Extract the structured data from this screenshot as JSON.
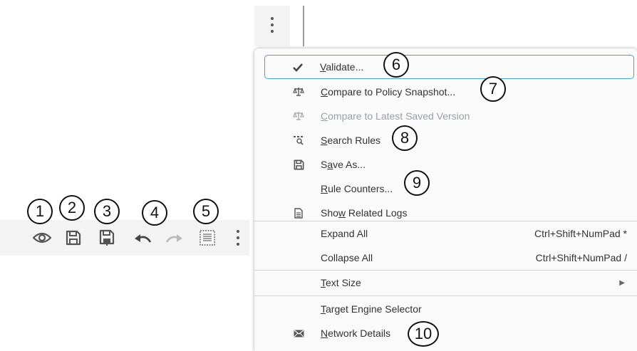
{
  "callouts": [
    "1",
    "2",
    "3",
    "4",
    "5",
    "6",
    "7",
    "8",
    "9",
    "10"
  ],
  "menu": {
    "items": [
      {
        "key": "validate",
        "underline": "V",
        "rest": "alidate...",
        "icon": "checkmark-icon"
      },
      {
        "key": "compare-snapshot",
        "underline": "C",
        "rest": "ompare to Policy Snapshot...",
        "icon": "balance-scale-icon"
      },
      {
        "key": "compare-latest",
        "underline": "C",
        "rest": "ompare to Latest Saved Version",
        "icon": "balance-scale-icon",
        "disabled": true
      },
      {
        "key": "search-rules",
        "underline": "S",
        "rest": "earch Rules",
        "icon": "search-rules-icon"
      },
      {
        "key": "save-as",
        "pre": "S",
        "underline": "a",
        "rest": "ve As...",
        "icon": "save-icon"
      },
      {
        "key": "rule-counters",
        "underline": "R",
        "rest": "ule Counters...",
        "icon": ""
      },
      {
        "key": "show-related-logs",
        "pre": "Sho",
        "underline": "w",
        "rest": " Related Logs",
        "icon": "document-icon"
      },
      {
        "key": "expand-all",
        "label": "Expand All",
        "shortcut": "Ctrl+Shift+NumPad *"
      },
      {
        "key": "collapse-all",
        "label": "Collapse All",
        "shortcut": "Ctrl+Shift+NumPad /"
      },
      {
        "key": "text-size",
        "underline": "T",
        "rest": "ext Size",
        "submenu": true
      },
      {
        "key": "target-engine",
        "underline": "T",
        "rest": "arget Engine Selector"
      },
      {
        "key": "network-details",
        "underline": "N",
        "rest": "etwork Details",
        "icon": "envelope-icon"
      }
    ]
  },
  "toolbar": {
    "buttons": [
      "eye-icon",
      "save-icon",
      "save-install-icon",
      "undo-icon",
      "redo-icon",
      "select-all-icon",
      "kebab-icon"
    ]
  }
}
